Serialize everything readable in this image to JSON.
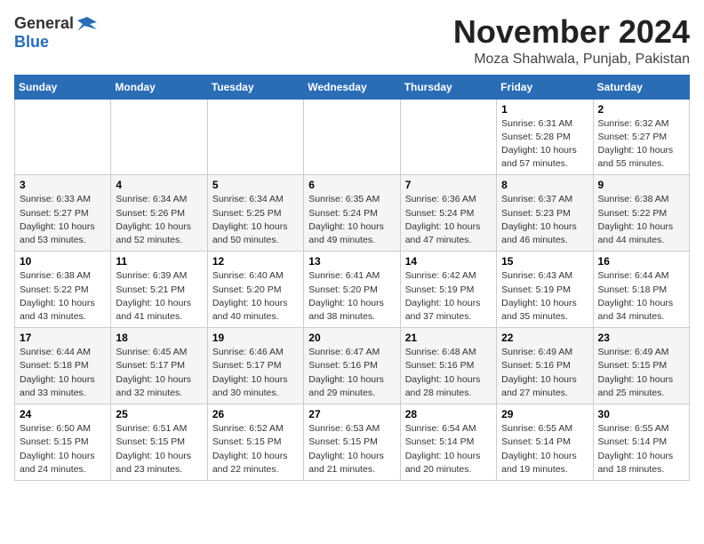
{
  "logo": {
    "general": "General",
    "blue": "Blue"
  },
  "header": {
    "month": "November 2024",
    "location": "Moza Shahwala, Punjab, Pakistan"
  },
  "days_of_week": [
    "Sunday",
    "Monday",
    "Tuesday",
    "Wednesday",
    "Thursday",
    "Friday",
    "Saturday"
  ],
  "weeks": [
    [
      {
        "day": "",
        "info": ""
      },
      {
        "day": "",
        "info": ""
      },
      {
        "day": "",
        "info": ""
      },
      {
        "day": "",
        "info": ""
      },
      {
        "day": "",
        "info": ""
      },
      {
        "day": "1",
        "info": "Sunrise: 6:31 AM\nSunset: 5:28 PM\nDaylight: 10 hours\nand 57 minutes."
      },
      {
        "day": "2",
        "info": "Sunrise: 6:32 AM\nSunset: 5:27 PM\nDaylight: 10 hours\nand 55 minutes."
      }
    ],
    [
      {
        "day": "3",
        "info": "Sunrise: 6:33 AM\nSunset: 5:27 PM\nDaylight: 10 hours\nand 53 minutes."
      },
      {
        "day": "4",
        "info": "Sunrise: 6:34 AM\nSunset: 5:26 PM\nDaylight: 10 hours\nand 52 minutes."
      },
      {
        "day": "5",
        "info": "Sunrise: 6:34 AM\nSunset: 5:25 PM\nDaylight: 10 hours\nand 50 minutes."
      },
      {
        "day": "6",
        "info": "Sunrise: 6:35 AM\nSunset: 5:24 PM\nDaylight: 10 hours\nand 49 minutes."
      },
      {
        "day": "7",
        "info": "Sunrise: 6:36 AM\nSunset: 5:24 PM\nDaylight: 10 hours\nand 47 minutes."
      },
      {
        "day": "8",
        "info": "Sunrise: 6:37 AM\nSunset: 5:23 PM\nDaylight: 10 hours\nand 46 minutes."
      },
      {
        "day": "9",
        "info": "Sunrise: 6:38 AM\nSunset: 5:22 PM\nDaylight: 10 hours\nand 44 minutes."
      }
    ],
    [
      {
        "day": "10",
        "info": "Sunrise: 6:38 AM\nSunset: 5:22 PM\nDaylight: 10 hours\nand 43 minutes."
      },
      {
        "day": "11",
        "info": "Sunrise: 6:39 AM\nSunset: 5:21 PM\nDaylight: 10 hours\nand 41 minutes."
      },
      {
        "day": "12",
        "info": "Sunrise: 6:40 AM\nSunset: 5:20 PM\nDaylight: 10 hours\nand 40 minutes."
      },
      {
        "day": "13",
        "info": "Sunrise: 6:41 AM\nSunset: 5:20 PM\nDaylight: 10 hours\nand 38 minutes."
      },
      {
        "day": "14",
        "info": "Sunrise: 6:42 AM\nSunset: 5:19 PM\nDaylight: 10 hours\nand 37 minutes."
      },
      {
        "day": "15",
        "info": "Sunrise: 6:43 AM\nSunset: 5:19 PM\nDaylight: 10 hours\nand 35 minutes."
      },
      {
        "day": "16",
        "info": "Sunrise: 6:44 AM\nSunset: 5:18 PM\nDaylight: 10 hours\nand 34 minutes."
      }
    ],
    [
      {
        "day": "17",
        "info": "Sunrise: 6:44 AM\nSunset: 5:18 PM\nDaylight: 10 hours\nand 33 minutes."
      },
      {
        "day": "18",
        "info": "Sunrise: 6:45 AM\nSunset: 5:17 PM\nDaylight: 10 hours\nand 32 minutes."
      },
      {
        "day": "19",
        "info": "Sunrise: 6:46 AM\nSunset: 5:17 PM\nDaylight: 10 hours\nand 30 minutes."
      },
      {
        "day": "20",
        "info": "Sunrise: 6:47 AM\nSunset: 5:16 PM\nDaylight: 10 hours\nand 29 minutes."
      },
      {
        "day": "21",
        "info": "Sunrise: 6:48 AM\nSunset: 5:16 PM\nDaylight: 10 hours\nand 28 minutes."
      },
      {
        "day": "22",
        "info": "Sunrise: 6:49 AM\nSunset: 5:16 PM\nDaylight: 10 hours\nand 27 minutes."
      },
      {
        "day": "23",
        "info": "Sunrise: 6:49 AM\nSunset: 5:15 PM\nDaylight: 10 hours\nand 25 minutes."
      }
    ],
    [
      {
        "day": "24",
        "info": "Sunrise: 6:50 AM\nSunset: 5:15 PM\nDaylight: 10 hours\nand 24 minutes."
      },
      {
        "day": "25",
        "info": "Sunrise: 6:51 AM\nSunset: 5:15 PM\nDaylight: 10 hours\nand 23 minutes."
      },
      {
        "day": "26",
        "info": "Sunrise: 6:52 AM\nSunset: 5:15 PM\nDaylight: 10 hours\nand 22 minutes."
      },
      {
        "day": "27",
        "info": "Sunrise: 6:53 AM\nSunset: 5:15 PM\nDaylight: 10 hours\nand 21 minutes."
      },
      {
        "day": "28",
        "info": "Sunrise: 6:54 AM\nSunset: 5:14 PM\nDaylight: 10 hours\nand 20 minutes."
      },
      {
        "day": "29",
        "info": "Sunrise: 6:55 AM\nSunset: 5:14 PM\nDaylight: 10 hours\nand 19 minutes."
      },
      {
        "day": "30",
        "info": "Sunrise: 6:55 AM\nSunset: 5:14 PM\nDaylight: 10 hours\nand 18 minutes."
      }
    ]
  ]
}
